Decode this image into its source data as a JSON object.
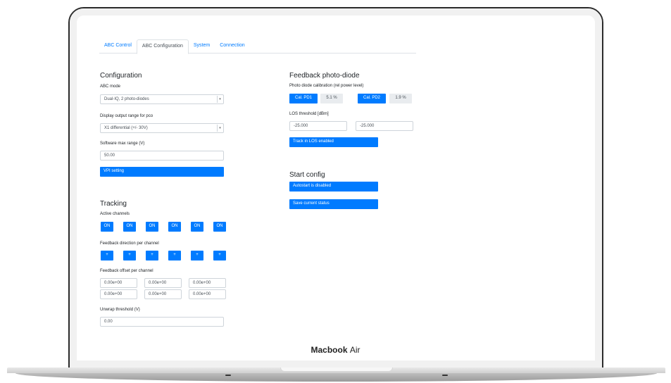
{
  "device": {
    "brand": "Macbook",
    "model": "Air"
  },
  "tabs": [
    "ABC Control",
    "ABC Configuration",
    "System",
    "Connection"
  ],
  "configuration": {
    "title": "Configuration",
    "abc_mode_label": "ABC mode",
    "abc_mode_value": "Dual-IQ, 2 photo-diodes",
    "display_range_label": "Display output range for pco",
    "display_range_value": "X1 differential (+/- 30V)",
    "software_max_label": "Software max range (V)",
    "software_max_value": "50.00",
    "vpi_button": "VPI setting"
  },
  "tracking": {
    "title": "Tracking",
    "active_channels_label": "Active channels",
    "active_channels": [
      "ON",
      "ON",
      "ON",
      "ON",
      "ON",
      "ON"
    ],
    "feedback_direction_label": "Feedback direction per channel",
    "feedback_direction": [
      "+",
      "+",
      "+",
      "+",
      "+",
      "+"
    ],
    "feedback_offset_label": "Feedback offset per channel",
    "feedback_offsets": [
      "0.00e+00",
      "0.00e+00",
      "0.00e+00",
      "0.00e+00",
      "0.00e+00",
      "0.00e+00"
    ],
    "unwrap_label": "Unwrap threshold (V)",
    "unwrap_value": "0.00"
  },
  "feedback_pd": {
    "title": "Feedback photo-diode",
    "calibration_label": "Photo diode calibration (rel power level)",
    "cal_pd1_button": "Cal. PD1",
    "pd1_value": "5.1 %",
    "cal_pd2_button": "Cal. PD2",
    "pd2_value": "1.9 %",
    "los_label": "LOS threshold [dBm]",
    "los_values": [
      "-25.000",
      "-25.000"
    ],
    "track_los_button": "Track in LOS enabled"
  },
  "start_config": {
    "title": "Start config",
    "autostart_button": "Autostart is disabled",
    "save_button": "Save current status"
  }
}
